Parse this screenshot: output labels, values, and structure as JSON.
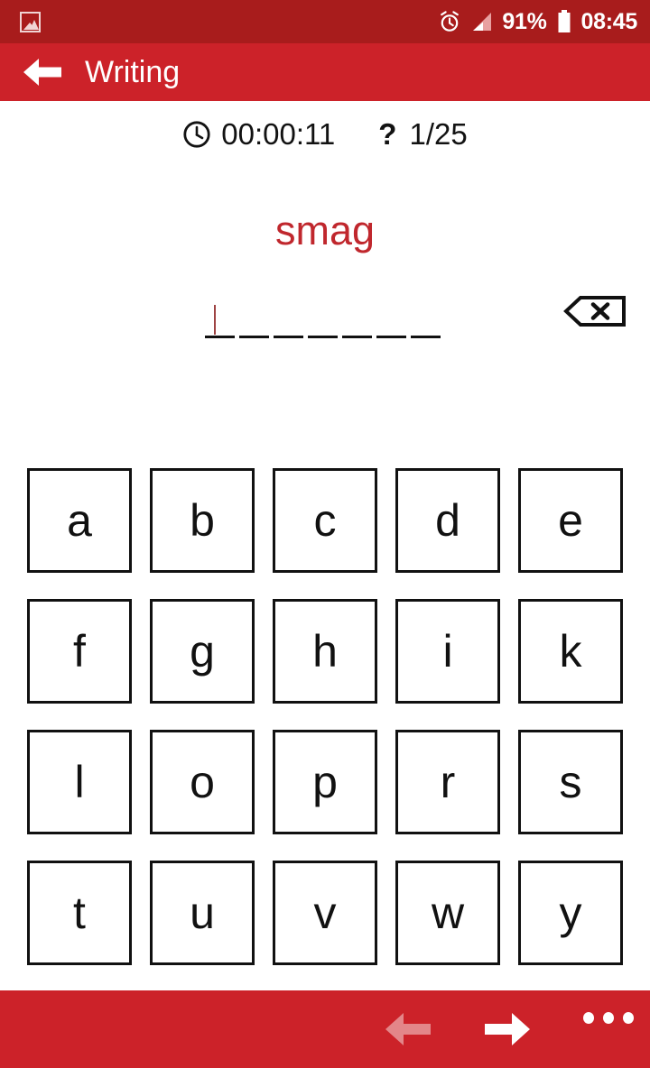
{
  "status_bar": {
    "background": "#a81c1c",
    "photo_icon": "photo-icon",
    "alarm_icon": "alarm-icon",
    "signal_icon": "signal-icon",
    "battery_icon": "battery-icon",
    "battery_percent": "91%",
    "clock_time": "08:45"
  },
  "app_bar": {
    "background": "#cc2229",
    "back_icon": "back-arrow-icon",
    "title": "Writing"
  },
  "exercise": {
    "clock_icon": "clock-icon",
    "elapsed_time": "00:00:11",
    "question_icon": "question-mark-icon",
    "progress": "1/25",
    "prompt_word": "smag",
    "prompt_color": "#c0272d",
    "answer_slots": [
      "",
      "",
      "",
      "",
      "",
      "",
      ""
    ],
    "slot_count": 7,
    "caret_index": 0,
    "caret_color": "#9e4343",
    "backspace_icon": "backspace-icon"
  },
  "keyboard": {
    "rows": [
      [
        "a",
        "b",
        "c",
        "d",
        "e"
      ],
      [
        "f",
        "g",
        "h",
        "i",
        "k"
      ],
      [
        "l",
        "o",
        "p",
        "r",
        "s"
      ],
      [
        "t",
        "u",
        "v",
        "w",
        "y"
      ]
    ]
  },
  "bottom_bar": {
    "background": "#cc2229",
    "prev_icon": "arrow-left-icon",
    "next_icon": "arrow-right-icon",
    "overflow_icon": "overflow-menu-icon",
    "prev_enabled": "false",
    "next_enabled": "true"
  }
}
